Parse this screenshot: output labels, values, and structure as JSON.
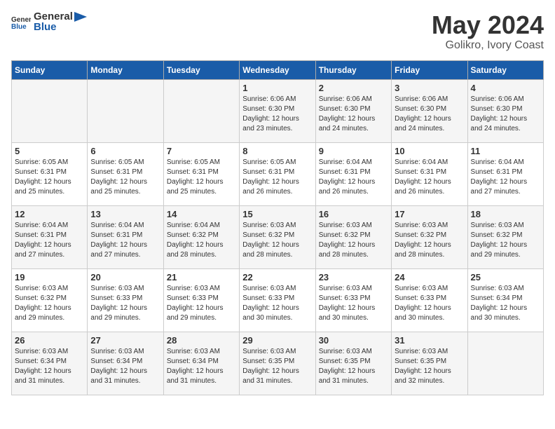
{
  "header": {
    "logo_general": "General",
    "logo_blue": "Blue",
    "title": "May 2024",
    "subtitle": "Golikro, Ivory Coast"
  },
  "days_of_week": [
    "Sunday",
    "Monday",
    "Tuesday",
    "Wednesday",
    "Thursday",
    "Friday",
    "Saturday"
  ],
  "weeks": [
    [
      {
        "num": "",
        "info": ""
      },
      {
        "num": "",
        "info": ""
      },
      {
        "num": "",
        "info": ""
      },
      {
        "num": "1",
        "info": "Sunrise: 6:06 AM\nSunset: 6:30 PM\nDaylight: 12 hours\nand 23 minutes."
      },
      {
        "num": "2",
        "info": "Sunrise: 6:06 AM\nSunset: 6:30 PM\nDaylight: 12 hours\nand 24 minutes."
      },
      {
        "num": "3",
        "info": "Sunrise: 6:06 AM\nSunset: 6:30 PM\nDaylight: 12 hours\nand 24 minutes."
      },
      {
        "num": "4",
        "info": "Sunrise: 6:06 AM\nSunset: 6:30 PM\nDaylight: 12 hours\nand 24 minutes."
      }
    ],
    [
      {
        "num": "5",
        "info": "Sunrise: 6:05 AM\nSunset: 6:31 PM\nDaylight: 12 hours\nand 25 minutes."
      },
      {
        "num": "6",
        "info": "Sunrise: 6:05 AM\nSunset: 6:31 PM\nDaylight: 12 hours\nand 25 minutes."
      },
      {
        "num": "7",
        "info": "Sunrise: 6:05 AM\nSunset: 6:31 PM\nDaylight: 12 hours\nand 25 minutes."
      },
      {
        "num": "8",
        "info": "Sunrise: 6:05 AM\nSunset: 6:31 PM\nDaylight: 12 hours\nand 26 minutes."
      },
      {
        "num": "9",
        "info": "Sunrise: 6:04 AM\nSunset: 6:31 PM\nDaylight: 12 hours\nand 26 minutes."
      },
      {
        "num": "10",
        "info": "Sunrise: 6:04 AM\nSunset: 6:31 PM\nDaylight: 12 hours\nand 26 minutes."
      },
      {
        "num": "11",
        "info": "Sunrise: 6:04 AM\nSunset: 6:31 PM\nDaylight: 12 hours\nand 27 minutes."
      }
    ],
    [
      {
        "num": "12",
        "info": "Sunrise: 6:04 AM\nSunset: 6:31 PM\nDaylight: 12 hours\nand 27 minutes."
      },
      {
        "num": "13",
        "info": "Sunrise: 6:04 AM\nSunset: 6:31 PM\nDaylight: 12 hours\nand 27 minutes."
      },
      {
        "num": "14",
        "info": "Sunrise: 6:04 AM\nSunset: 6:32 PM\nDaylight: 12 hours\nand 28 minutes."
      },
      {
        "num": "15",
        "info": "Sunrise: 6:03 AM\nSunset: 6:32 PM\nDaylight: 12 hours\nand 28 minutes."
      },
      {
        "num": "16",
        "info": "Sunrise: 6:03 AM\nSunset: 6:32 PM\nDaylight: 12 hours\nand 28 minutes."
      },
      {
        "num": "17",
        "info": "Sunrise: 6:03 AM\nSunset: 6:32 PM\nDaylight: 12 hours\nand 28 minutes."
      },
      {
        "num": "18",
        "info": "Sunrise: 6:03 AM\nSunset: 6:32 PM\nDaylight: 12 hours\nand 29 minutes."
      }
    ],
    [
      {
        "num": "19",
        "info": "Sunrise: 6:03 AM\nSunset: 6:32 PM\nDaylight: 12 hours\nand 29 minutes."
      },
      {
        "num": "20",
        "info": "Sunrise: 6:03 AM\nSunset: 6:33 PM\nDaylight: 12 hours\nand 29 minutes."
      },
      {
        "num": "21",
        "info": "Sunrise: 6:03 AM\nSunset: 6:33 PM\nDaylight: 12 hours\nand 29 minutes."
      },
      {
        "num": "22",
        "info": "Sunrise: 6:03 AM\nSunset: 6:33 PM\nDaylight: 12 hours\nand 30 minutes."
      },
      {
        "num": "23",
        "info": "Sunrise: 6:03 AM\nSunset: 6:33 PM\nDaylight: 12 hours\nand 30 minutes."
      },
      {
        "num": "24",
        "info": "Sunrise: 6:03 AM\nSunset: 6:33 PM\nDaylight: 12 hours\nand 30 minutes."
      },
      {
        "num": "25",
        "info": "Sunrise: 6:03 AM\nSunset: 6:34 PM\nDaylight: 12 hours\nand 30 minutes."
      }
    ],
    [
      {
        "num": "26",
        "info": "Sunrise: 6:03 AM\nSunset: 6:34 PM\nDaylight: 12 hours\nand 31 minutes."
      },
      {
        "num": "27",
        "info": "Sunrise: 6:03 AM\nSunset: 6:34 PM\nDaylight: 12 hours\nand 31 minutes."
      },
      {
        "num": "28",
        "info": "Sunrise: 6:03 AM\nSunset: 6:34 PM\nDaylight: 12 hours\nand 31 minutes."
      },
      {
        "num": "29",
        "info": "Sunrise: 6:03 AM\nSunset: 6:35 PM\nDaylight: 12 hours\nand 31 minutes."
      },
      {
        "num": "30",
        "info": "Sunrise: 6:03 AM\nSunset: 6:35 PM\nDaylight: 12 hours\nand 31 minutes."
      },
      {
        "num": "31",
        "info": "Sunrise: 6:03 AM\nSunset: 6:35 PM\nDaylight: 12 hours\nand 32 minutes."
      },
      {
        "num": "",
        "info": ""
      }
    ]
  ]
}
